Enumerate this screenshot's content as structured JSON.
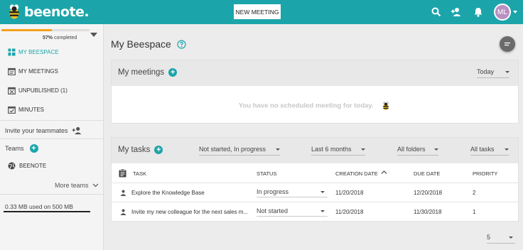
{
  "app": {
    "logo_text": "beenote."
  },
  "topbar": {
    "new_meeting_label": "NEW MEETING",
    "icons": [
      "search-icon",
      "add-person-icon",
      "bell-icon"
    ],
    "avatar_initials": "ML",
    "avatar_color": "#b98fc2",
    "accent_color": "#1ba5aa"
  },
  "sidebar": {
    "progress": {
      "percent": 57,
      "label_value": "57%",
      "label_suffix": "completed"
    },
    "nav": [
      {
        "label": "MY BEESPACE",
        "icon": "beespace-icon"
      },
      {
        "label": "MY MEETINGS",
        "icon": "meetings-icon"
      },
      {
        "label": "UNPUBLISHED (1)",
        "icon": "unpublished-icon"
      },
      {
        "label": "MINUTES",
        "icon": "minutes-icon"
      }
    ],
    "invite_label": "Invite your teammates",
    "teams_label": "Teams",
    "teams": [
      {
        "label": "BEENOTE"
      }
    ],
    "more_teams_label": "More teams",
    "storage_label": "0.33 MB used on 500 MB"
  },
  "main": {
    "title": "My Beespace",
    "meetings": {
      "title": "My meetings",
      "filter": "Today",
      "empty_message": "You have no scheduled meeting for today."
    },
    "tasks": {
      "title": "My tasks",
      "filters": {
        "status": "Not started, In progress",
        "period": "Last 6 months",
        "folders": "All folders",
        "tasks": "All tasks"
      },
      "columns": {
        "task": "TASK",
        "status": "STATUS",
        "creation_date": "CREATION DATE",
        "due_date": "DUE DATE",
        "priority": "PRIORITY"
      },
      "rows": [
        {
          "task": "Explore the Knowledge Base",
          "status": "In progress",
          "creation_date": "11/20/2018",
          "due_date": "12/20/2018",
          "priority": "2"
        },
        {
          "task": "Invite my new colleague for the next sales m...",
          "status": "Not started",
          "creation_date": "11/20/2018",
          "due_date": "11/30/2018",
          "priority": "1"
        }
      ]
    },
    "page_size": "5"
  }
}
